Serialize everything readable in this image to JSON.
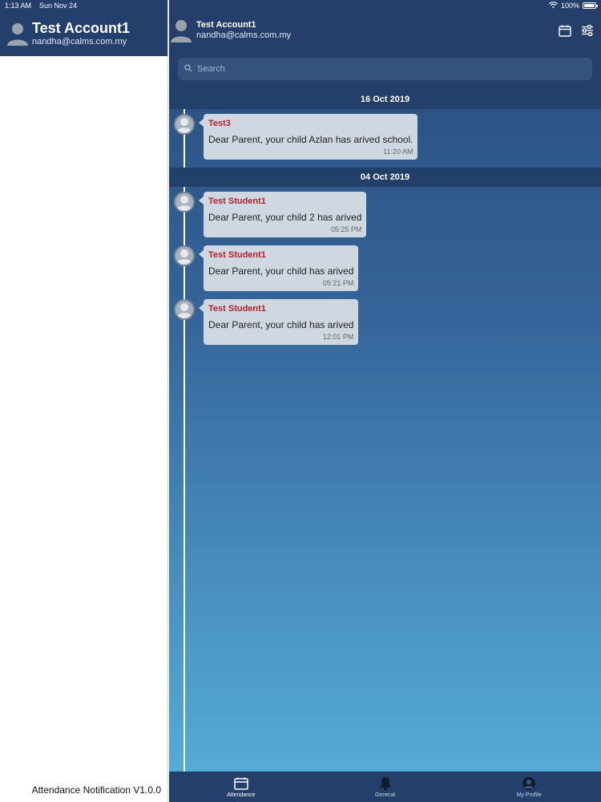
{
  "status_bar": {
    "time": "1:13 AM",
    "date": "Sun Nov 24",
    "battery": "100%"
  },
  "drawer": {
    "name": "Test Account1",
    "email": "nandha@calms.com.my",
    "version": "Attendance Notification V1.0.0"
  },
  "header": {
    "name": "Test Account1",
    "email": "nandha@calms.com.my"
  },
  "search": {
    "placeholder": "Search"
  },
  "groups": [
    {
      "date": "16 Oct 2019",
      "messages": [
        {
          "sender": "Test3",
          "text": "Dear Parent, your child Azlan has arived school.",
          "time": "11:20 AM"
        }
      ]
    },
    {
      "date": "04 Oct 2019",
      "messages": [
        {
          "sender": "Test Student1",
          "text": "Dear Parent, your child 2 has arived",
          "time": "05:25 PM"
        },
        {
          "sender": "Test Student1",
          "text": "Dear Parent, your child has arived",
          "time": "05:21 PM"
        },
        {
          "sender": "Test Student1",
          "text": "Dear Parent, your child has arived",
          "time": "12:01 PM"
        }
      ]
    }
  ],
  "tabs": [
    {
      "label": "Attendance",
      "icon": "calendar-icon",
      "active": true
    },
    {
      "label": "General",
      "icon": "bell-icon",
      "active": false
    },
    {
      "label": "My Profile",
      "icon": "profile-icon",
      "active": false
    }
  ],
  "colors": {
    "header": "#243f6b",
    "sender": "#b2232e",
    "bubble": "#cfd7e1"
  }
}
